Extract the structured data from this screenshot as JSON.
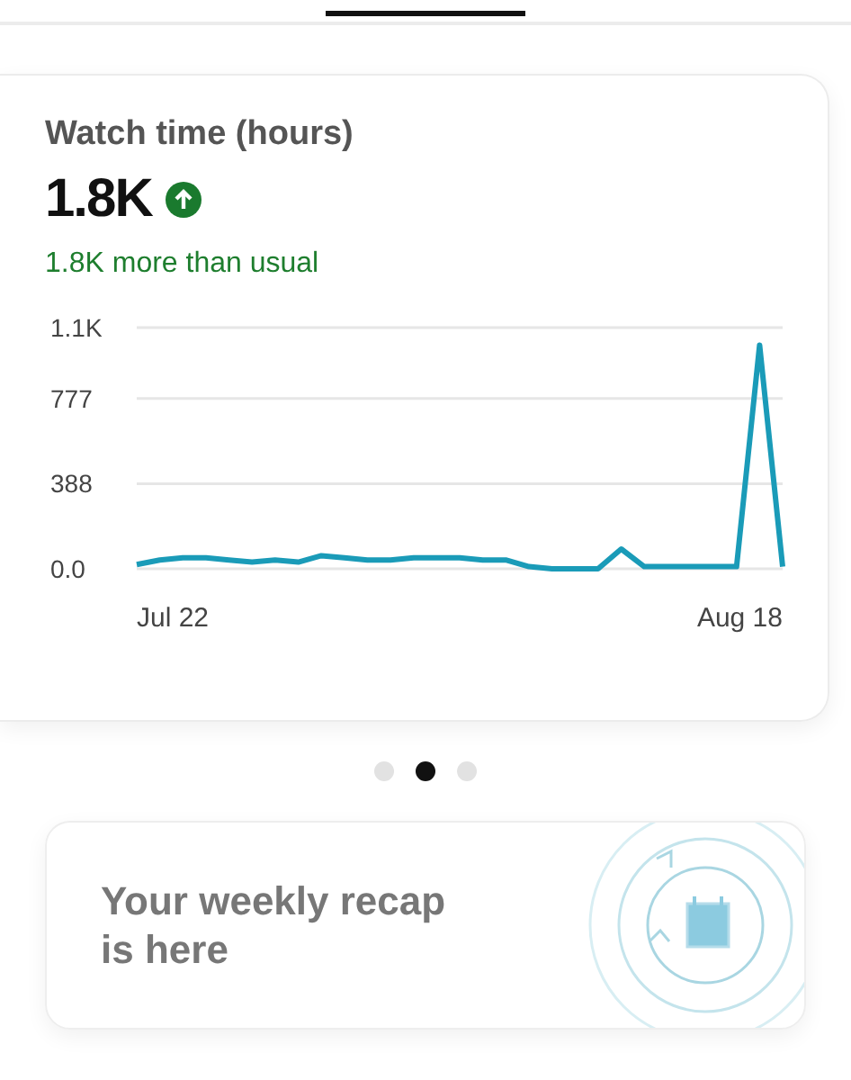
{
  "metric_card": {
    "title": "Watch time (hours)",
    "value": "1.8K",
    "trend_up": true,
    "comparison": "1.8K more than usual",
    "x_axis_labels": [
      "Jul 22",
      "Aug 18"
    ],
    "chart_data": {
      "type": "line",
      "ylim": [
        0,
        1100
      ],
      "grid": true,
      "yticks": [
        {
          "value": 0,
          "label": "0.0"
        },
        {
          "value": 388,
          "label": "388"
        },
        {
          "value": 777,
          "label": "777"
        },
        {
          "value": 1100,
          "label": "1.1K"
        }
      ],
      "series": [
        {
          "color": "#1a9bb8",
          "values": [
            20,
            40,
            50,
            50,
            40,
            30,
            40,
            30,
            60,
            50,
            40,
            40,
            50,
            50,
            50,
            40,
            40,
            10,
            0,
            0,
            0,
            90,
            10,
            10,
            10,
            10,
            10,
            1020,
            10
          ]
        }
      ]
    }
  },
  "pages": [
    {
      "selected": false
    },
    {
      "selected": true
    },
    {
      "selected": false
    }
  ],
  "recap": {
    "title": "Your weekly recap is here"
  }
}
